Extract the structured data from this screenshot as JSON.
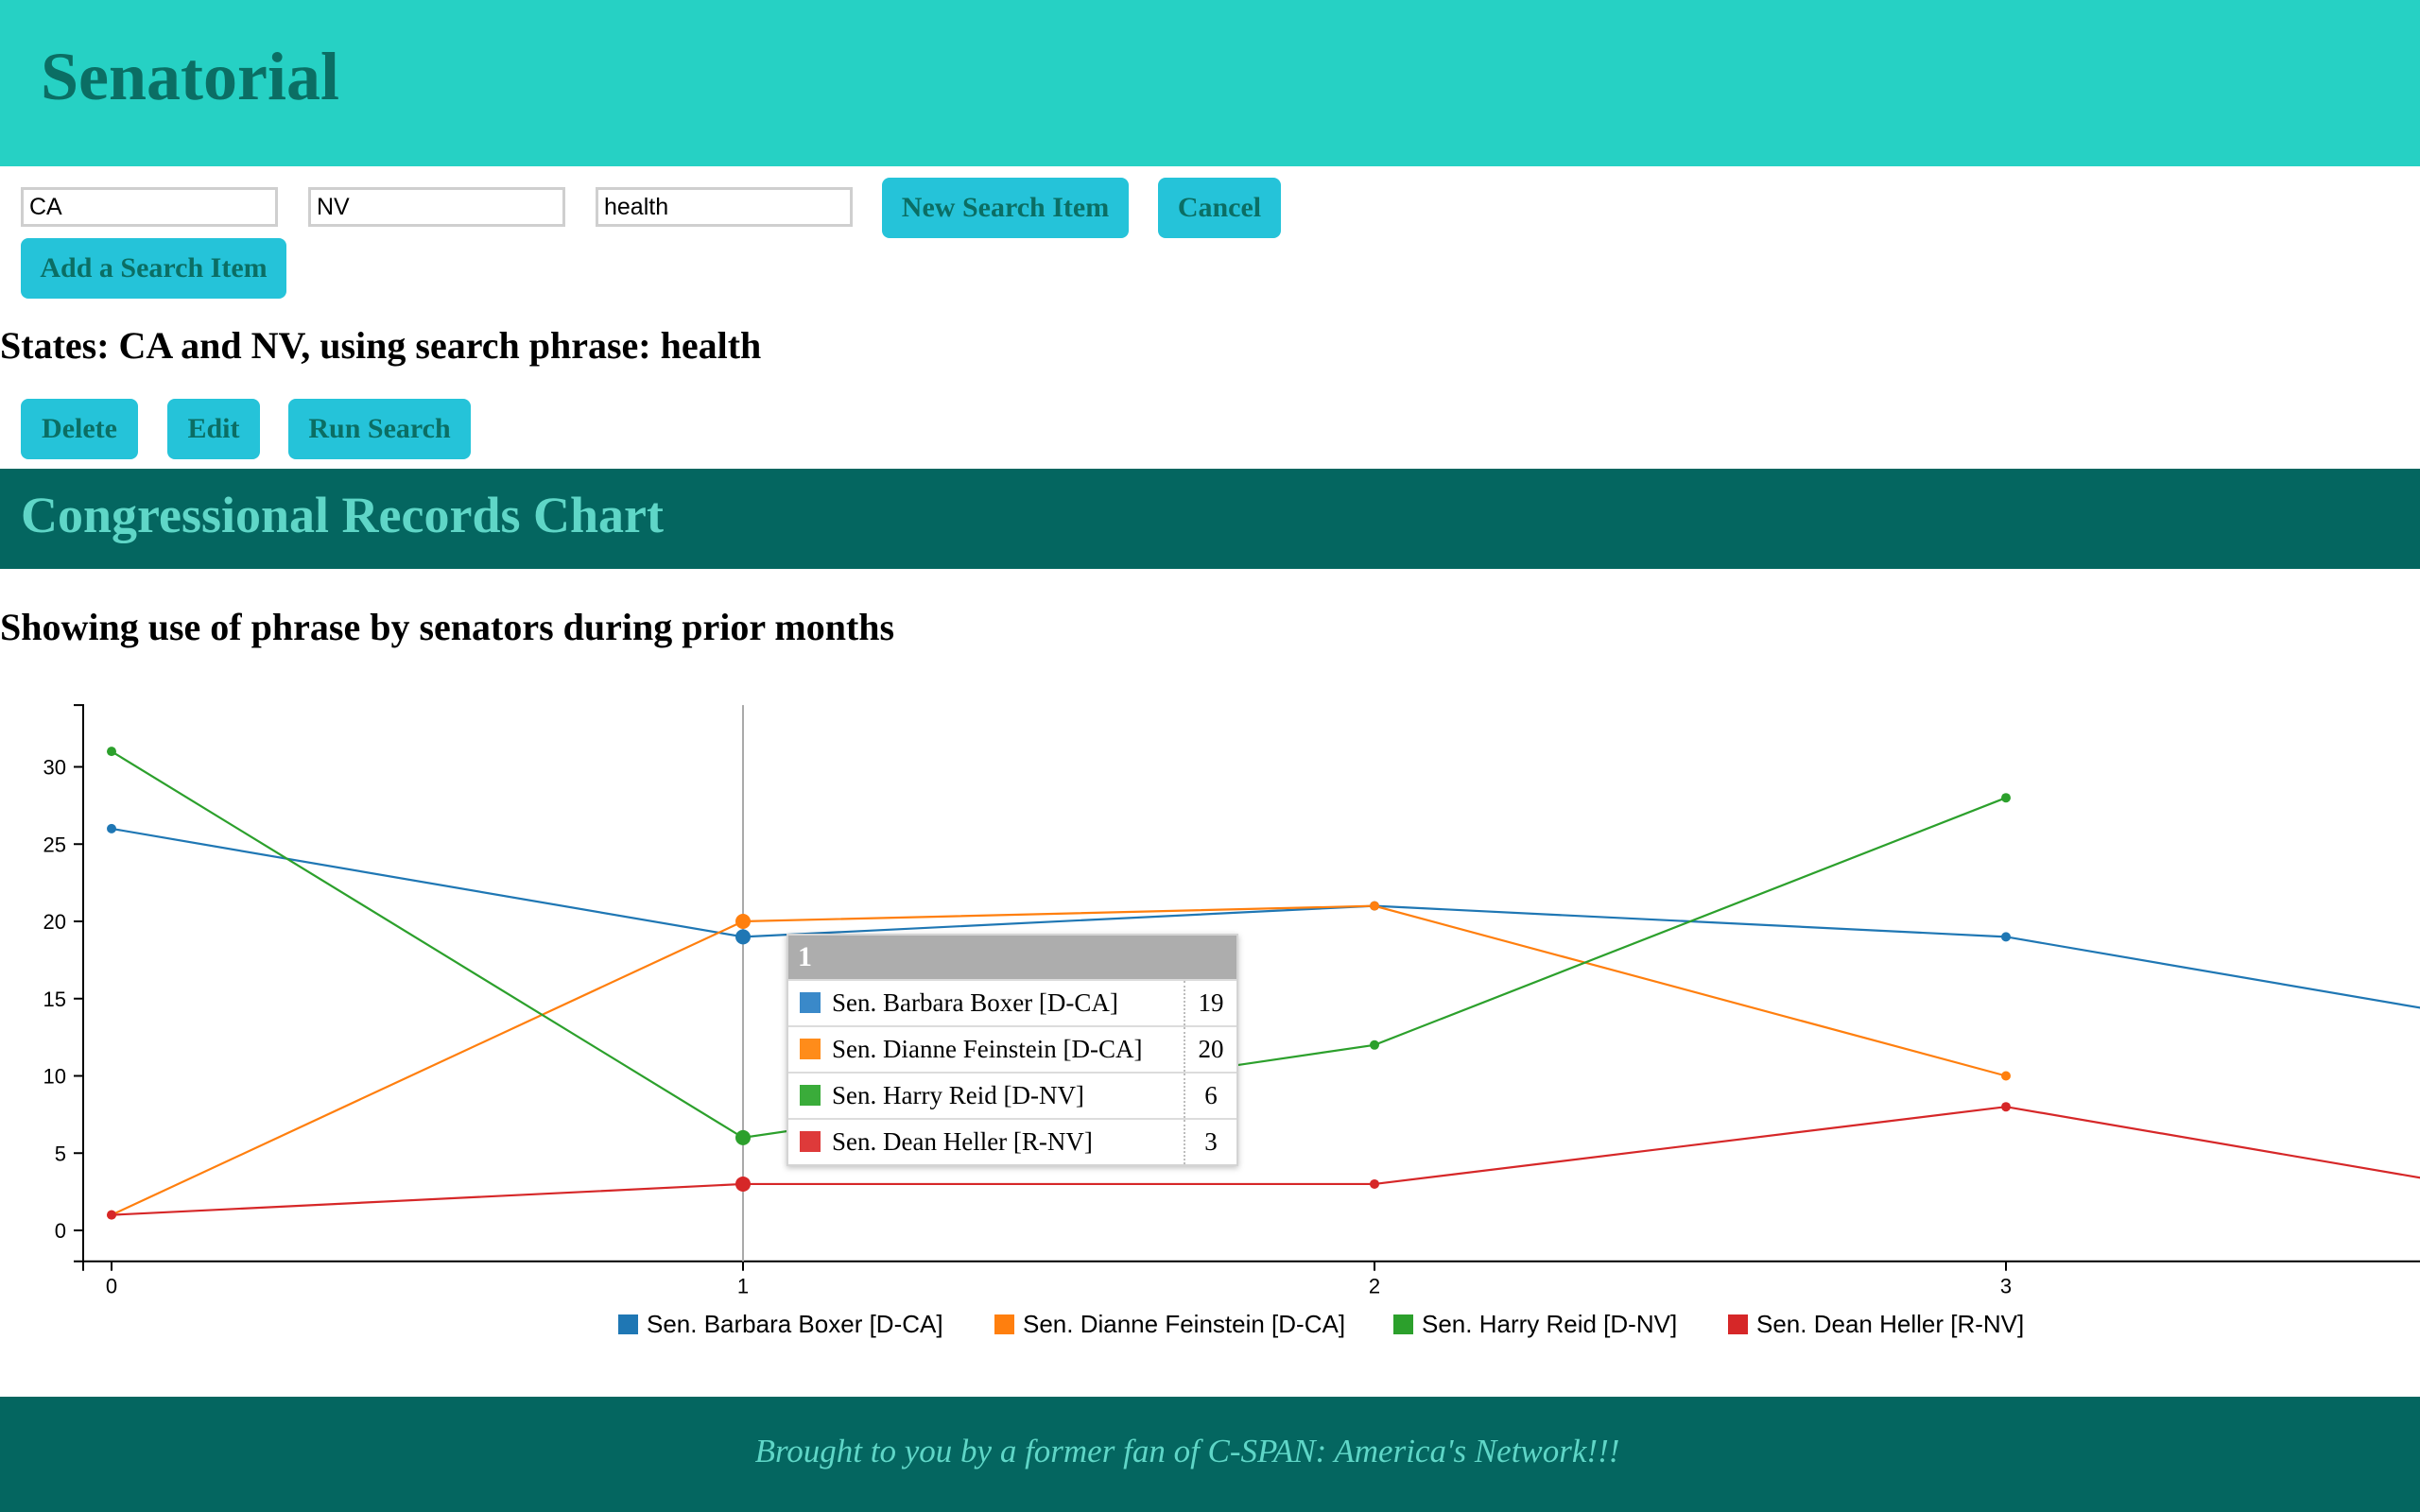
{
  "header": {
    "title": "Senatorial"
  },
  "search_form": {
    "state1_value": "CA",
    "state2_value": "NV",
    "phrase_value": "health",
    "new_search_label": "New Search Item",
    "cancel_label": "Cancel",
    "add_label": "Add a Search Item"
  },
  "search_item": {
    "summary": "States: CA and NV, using search phrase: health",
    "delete_label": "Delete",
    "edit_label": "Edit",
    "run_label": "Run Search"
  },
  "chart_section": {
    "title": "Congressional Records Chart",
    "subtitle": "Showing use of phrase by senators during prior months"
  },
  "chart_data": {
    "type": "line",
    "x": [
      0,
      1,
      2,
      3,
      4
    ],
    "xlim": [
      0,
      3.6
    ],
    "ylim": [
      -2,
      34
    ],
    "x_ticks": [
      0,
      1,
      2,
      3
    ],
    "y_ticks": [
      0,
      5,
      10,
      15,
      20,
      25,
      30
    ],
    "grid": false,
    "legend": "bottom",
    "series": [
      {
        "name": "Sen. Barbara Boxer [D-CA]",
        "color": "#1f77b4",
        "values": [
          26,
          19,
          21,
          19,
          12
        ]
      },
      {
        "name": "Sen. Dianne Feinstein [D-CA]",
        "color": "#ff7f0e",
        "values": [
          1,
          20,
          21,
          10,
          null
        ]
      },
      {
        "name": "Sen. Harry Reid [D-NV]",
        "color": "#2ca02c",
        "values": [
          31,
          6,
          12,
          28,
          null
        ]
      },
      {
        "name": "Sen. Dean Heller [R-NV]",
        "color": "#d62728",
        "values": [
          1,
          3,
          3,
          8,
          1
        ]
      }
    ],
    "focus_x": 1
  },
  "tooltip": {
    "title": "1",
    "rows": [
      {
        "name": "Sen. Barbara Boxer [D-CA]",
        "value": "19",
        "color": "#3a89c9"
      },
      {
        "name": "Sen. Dianne Feinstein [D-CA]",
        "value": "20",
        "color": "#ff8c1a"
      },
      {
        "name": "Sen. Harry Reid [D-NV]",
        "value": "6",
        "color": "#3aac3a"
      },
      {
        "name": "Sen. Dean Heller [R-NV]",
        "value": "3",
        "color": "#de3a3a"
      }
    ]
  },
  "footer": {
    "text": "Brought to you by a former fan of C-SPAN: America's Network!!!"
  }
}
